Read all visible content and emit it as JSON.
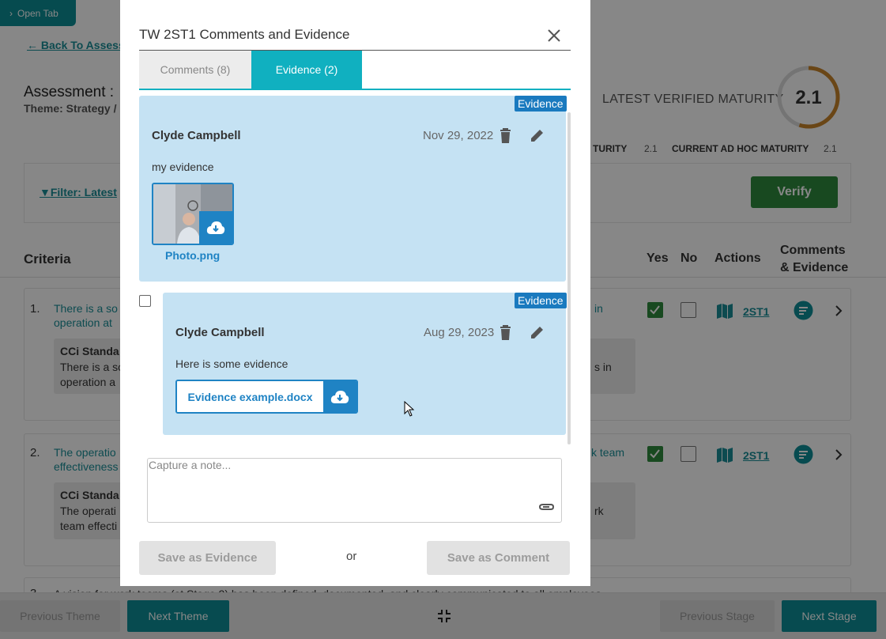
{
  "open_tab_label": "Open Tab",
  "back_link": "Back To Assess",
  "assessment": {
    "title": "Assessment :",
    "theme": "Theme: Strategy /"
  },
  "maturity": {
    "latest_label": "LATEST VERIFIED MATURITY",
    "latest_value": "2.1",
    "latest_fraction": 0.55,
    "ring_color": "#c9842a",
    "verified_small_label": "TURITY",
    "verified_small_value": "2.1",
    "adhoc_label": "CURRENT AD HOC MATURITY",
    "adhoc_value": "2.1"
  },
  "filter_label": "Filter: Latest",
  "verify_label": "Verify",
  "columns": {
    "criteria": "Criteria",
    "yes": "Yes",
    "no": "No",
    "actions": "Actions",
    "comments_line1": "Comments",
    "comments_line2": "& Evidence"
  },
  "criteria": [
    {
      "num": "1.",
      "line1": "There is a so",
      "line2": "operation at",
      "tail": "in",
      "std_title": "CCi Standa",
      "std_line1": "There is a so",
      "std_line2": "operation a",
      "std_tail": "s in",
      "yes": true,
      "no": false,
      "code": "2ST1"
    },
    {
      "num": "2.",
      "line1": "The operatio",
      "line2": "effectiveness",
      "tail": "k team",
      "std_title": "CCi Standa",
      "std_line1": "The operati",
      "std_line2": "team effecti",
      "std_tail": "rk",
      "yes": true,
      "no": false,
      "code": "2ST1"
    },
    {
      "num": "3.",
      "line1": "A vision for work teams (at Stage 2) has been defined, documented, and clearly communicated to all employees."
    }
  ],
  "footer": {
    "prev_theme": "Previous Theme",
    "next_theme": "Next Theme",
    "prev_stage": "Previous Stage",
    "next_stage": "Next Stage"
  },
  "modal": {
    "title": "TW 2ST1 Comments and Evidence",
    "tabs": [
      {
        "label": "Comments (8)"
      },
      {
        "label": "Evidence (2)"
      }
    ],
    "evidence": [
      {
        "badge": "Evidence",
        "author": "Clyde Campbell",
        "date": "Nov 29, 2022",
        "text": "my evidence",
        "attachment": "Photo.png"
      },
      {
        "badge": "Evidence",
        "author": "Clyde Campbell",
        "date": "Aug 29, 2023",
        "text": "Here is some evidence",
        "attachment": "Evidence example.docx"
      }
    ],
    "note_placeholder": "Capture a note...",
    "save_evidence": "Save as Evidence",
    "or": "or",
    "save_comment": "Save as Comment"
  },
  "colors": {
    "teal": "#10b0c0",
    "evidence_bg": "#c5e2f3",
    "badge": "#1a7abf",
    "verify": "#2f8a3d"
  }
}
